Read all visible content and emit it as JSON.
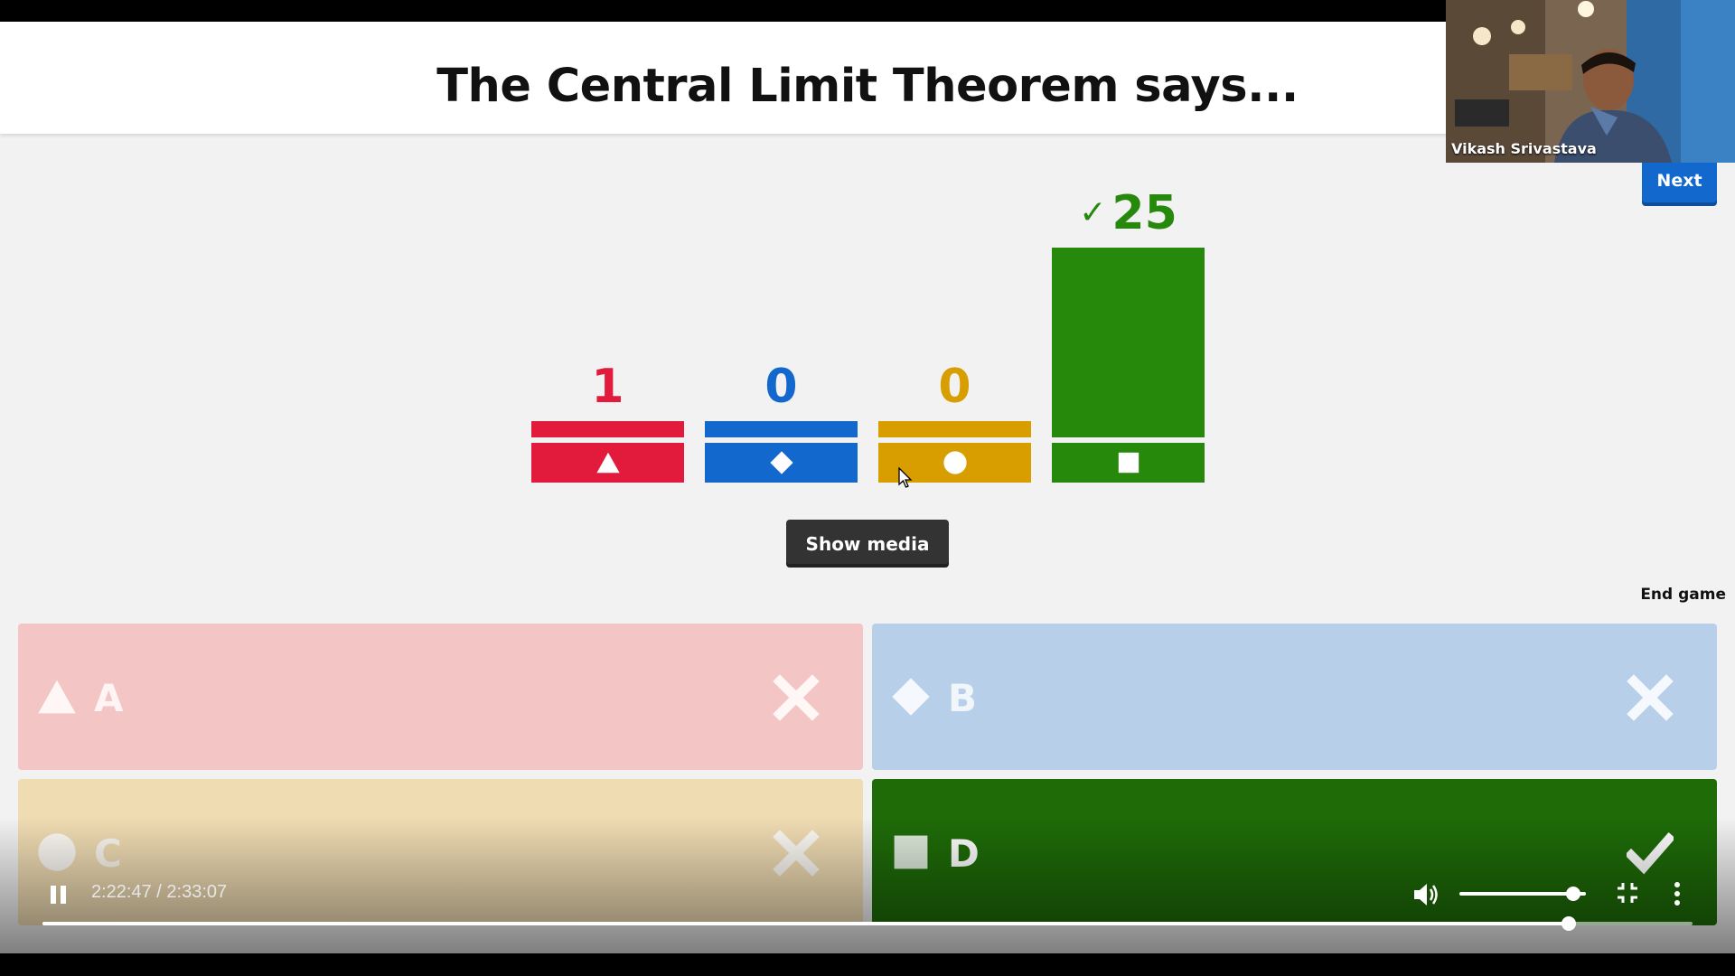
{
  "question": {
    "title": "The Central Limit Theorem says..."
  },
  "controls": {
    "next_label": "Next",
    "show_media_label": "Show media",
    "end_game_label": "End game"
  },
  "results": [
    {
      "shape": "triangle-icon",
      "count": "1",
      "value": 1,
      "color": "#e21b3c",
      "correct": false
    },
    {
      "shape": "diamond-icon",
      "count": "0",
      "value": 0,
      "color": "#1368ce",
      "correct": false
    },
    {
      "shape": "circle-icon",
      "count": "0",
      "value": 0,
      "color": "#d89e00",
      "correct": false
    },
    {
      "shape": "square-icon",
      "count": "25",
      "value": 25,
      "color": "#26890c",
      "correct": true
    }
  ],
  "answers": [
    {
      "letter": "A",
      "shape": "triangle-icon",
      "mark": "cross-icon",
      "bg": "#f3c5c4"
    },
    {
      "letter": "B",
      "shape": "diamond-icon",
      "mark": "cross-icon",
      "bg": "#b8cfe9"
    },
    {
      "letter": "C",
      "shape": "circle-icon",
      "mark": "cross-icon",
      "bg": "#f0dcb3"
    },
    {
      "letter": "D",
      "shape": "square-icon",
      "mark": "check-icon",
      "bg": "#1e6b08"
    }
  ],
  "webcam": {
    "name": "Vikash Srivastava"
  },
  "player": {
    "time": "2:22:47 / 2:33:07",
    "progress": 0.925,
    "volume": 0.9
  }
}
